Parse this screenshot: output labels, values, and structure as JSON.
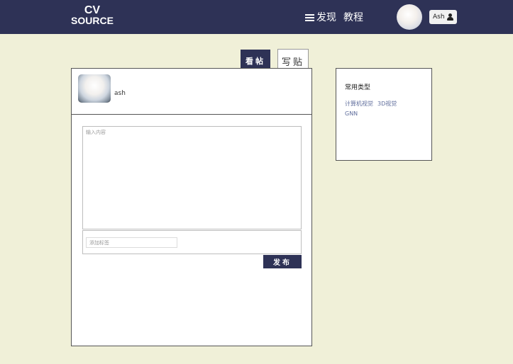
{
  "header": {
    "logo_line1": "CV",
    "logo_line2": "SOURCE",
    "nav": {
      "discover_label": "发现",
      "tutorial_label": "教程"
    },
    "user": {
      "name": "Ash"
    }
  },
  "tabs": {
    "view_label": "看帖",
    "write_label": "写贴"
  },
  "post_form": {
    "author_name": "ash",
    "content_placeholder": "输入内容",
    "tag_placeholder": "添加标签",
    "publish_label": "发布"
  },
  "sidebar": {
    "title": "常用类型",
    "links": [
      "计算机视觉",
      "3D视觉",
      "GNN"
    ]
  },
  "colors": {
    "navbar": "#2e3256",
    "background": "#f0f0d8",
    "link": "#5f6d9c"
  },
  "icons": [
    "menu-icon",
    "user-icon"
  ]
}
